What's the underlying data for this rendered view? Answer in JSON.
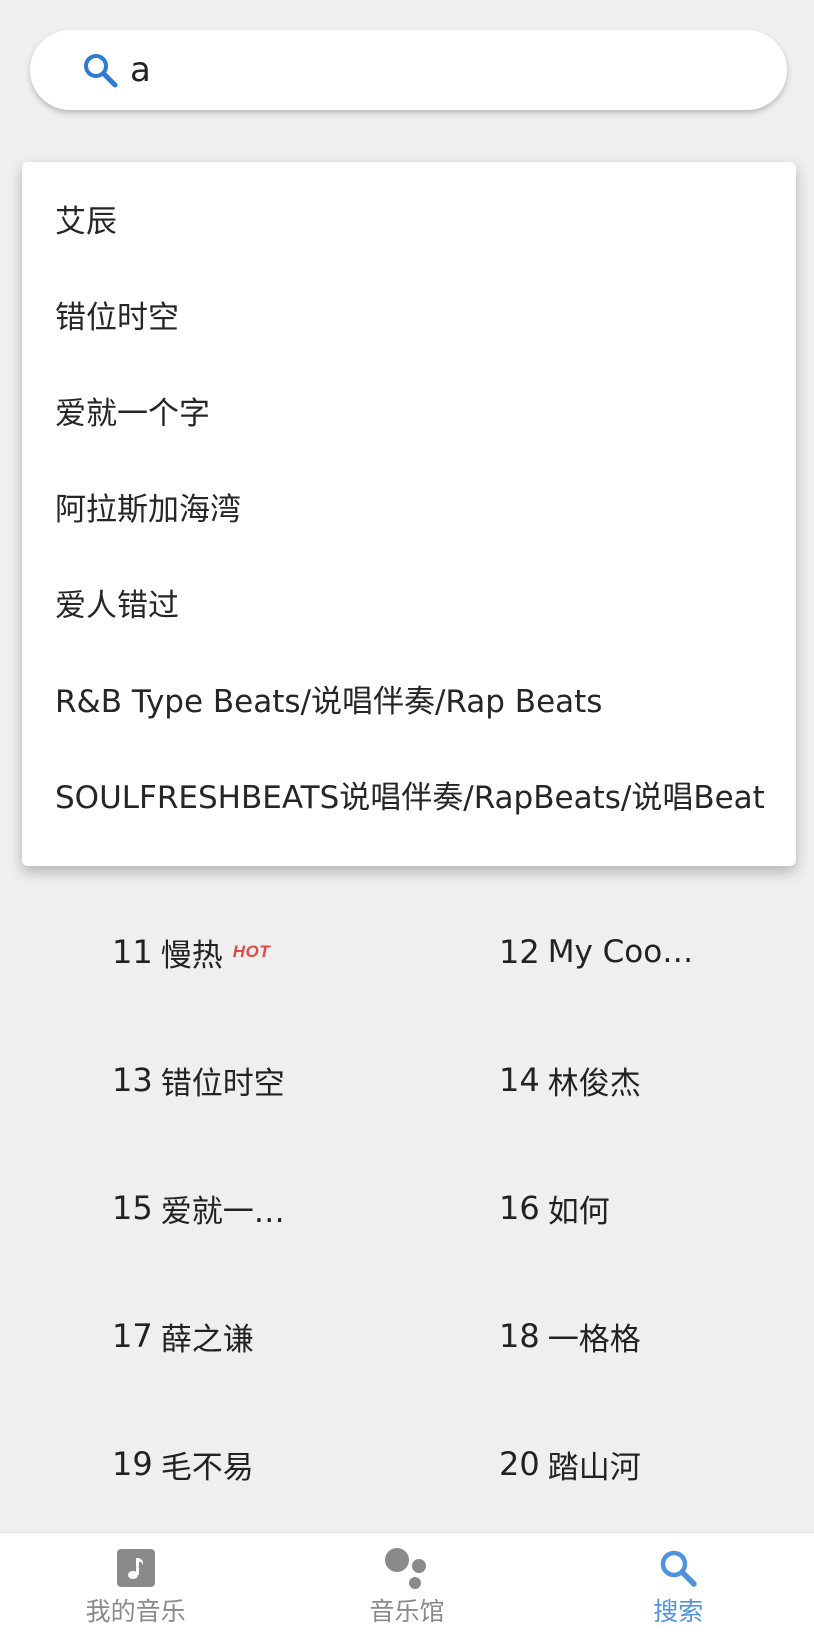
{
  "search": {
    "value": "a"
  },
  "suggestions": [
    "艾辰",
    "错位时空",
    "爱就一个字",
    "阿拉斯加海湾",
    "爱人错过",
    "R&B Type Beats/说唱伴奏/Rap Beats",
    "SOULFRESHBEATS说唱伴奏/RapBeats/说唱Beat"
  ],
  "hot_list": [
    {
      "num": "11",
      "name": "慢热",
      "badge": "HOT"
    },
    {
      "num": "12",
      "name": "My Coo…"
    },
    {
      "num": "13",
      "name": "错位时空"
    },
    {
      "num": "14",
      "name": "林俊杰"
    },
    {
      "num": "15",
      "name": "爱就一…"
    },
    {
      "num": "16",
      "name": "如何"
    },
    {
      "num": "17",
      "name": "薛之谦"
    },
    {
      "num": "18",
      "name": "一格格"
    },
    {
      "num": "19",
      "name": "毛不易"
    },
    {
      "num": "20",
      "name": "踏山河"
    }
  ],
  "nav": [
    {
      "label": "我的音乐",
      "icon": "music-note-icon",
      "active": false
    },
    {
      "label": "音乐馆",
      "icon": "music-hall-icon",
      "active": false
    },
    {
      "label": "搜索",
      "icon": "search-icon",
      "active": true
    }
  ],
  "colors": {
    "accent": "#4f93df",
    "search_icon": "#2f7ad6",
    "hot": "#e04848",
    "background": "#efefef"
  }
}
